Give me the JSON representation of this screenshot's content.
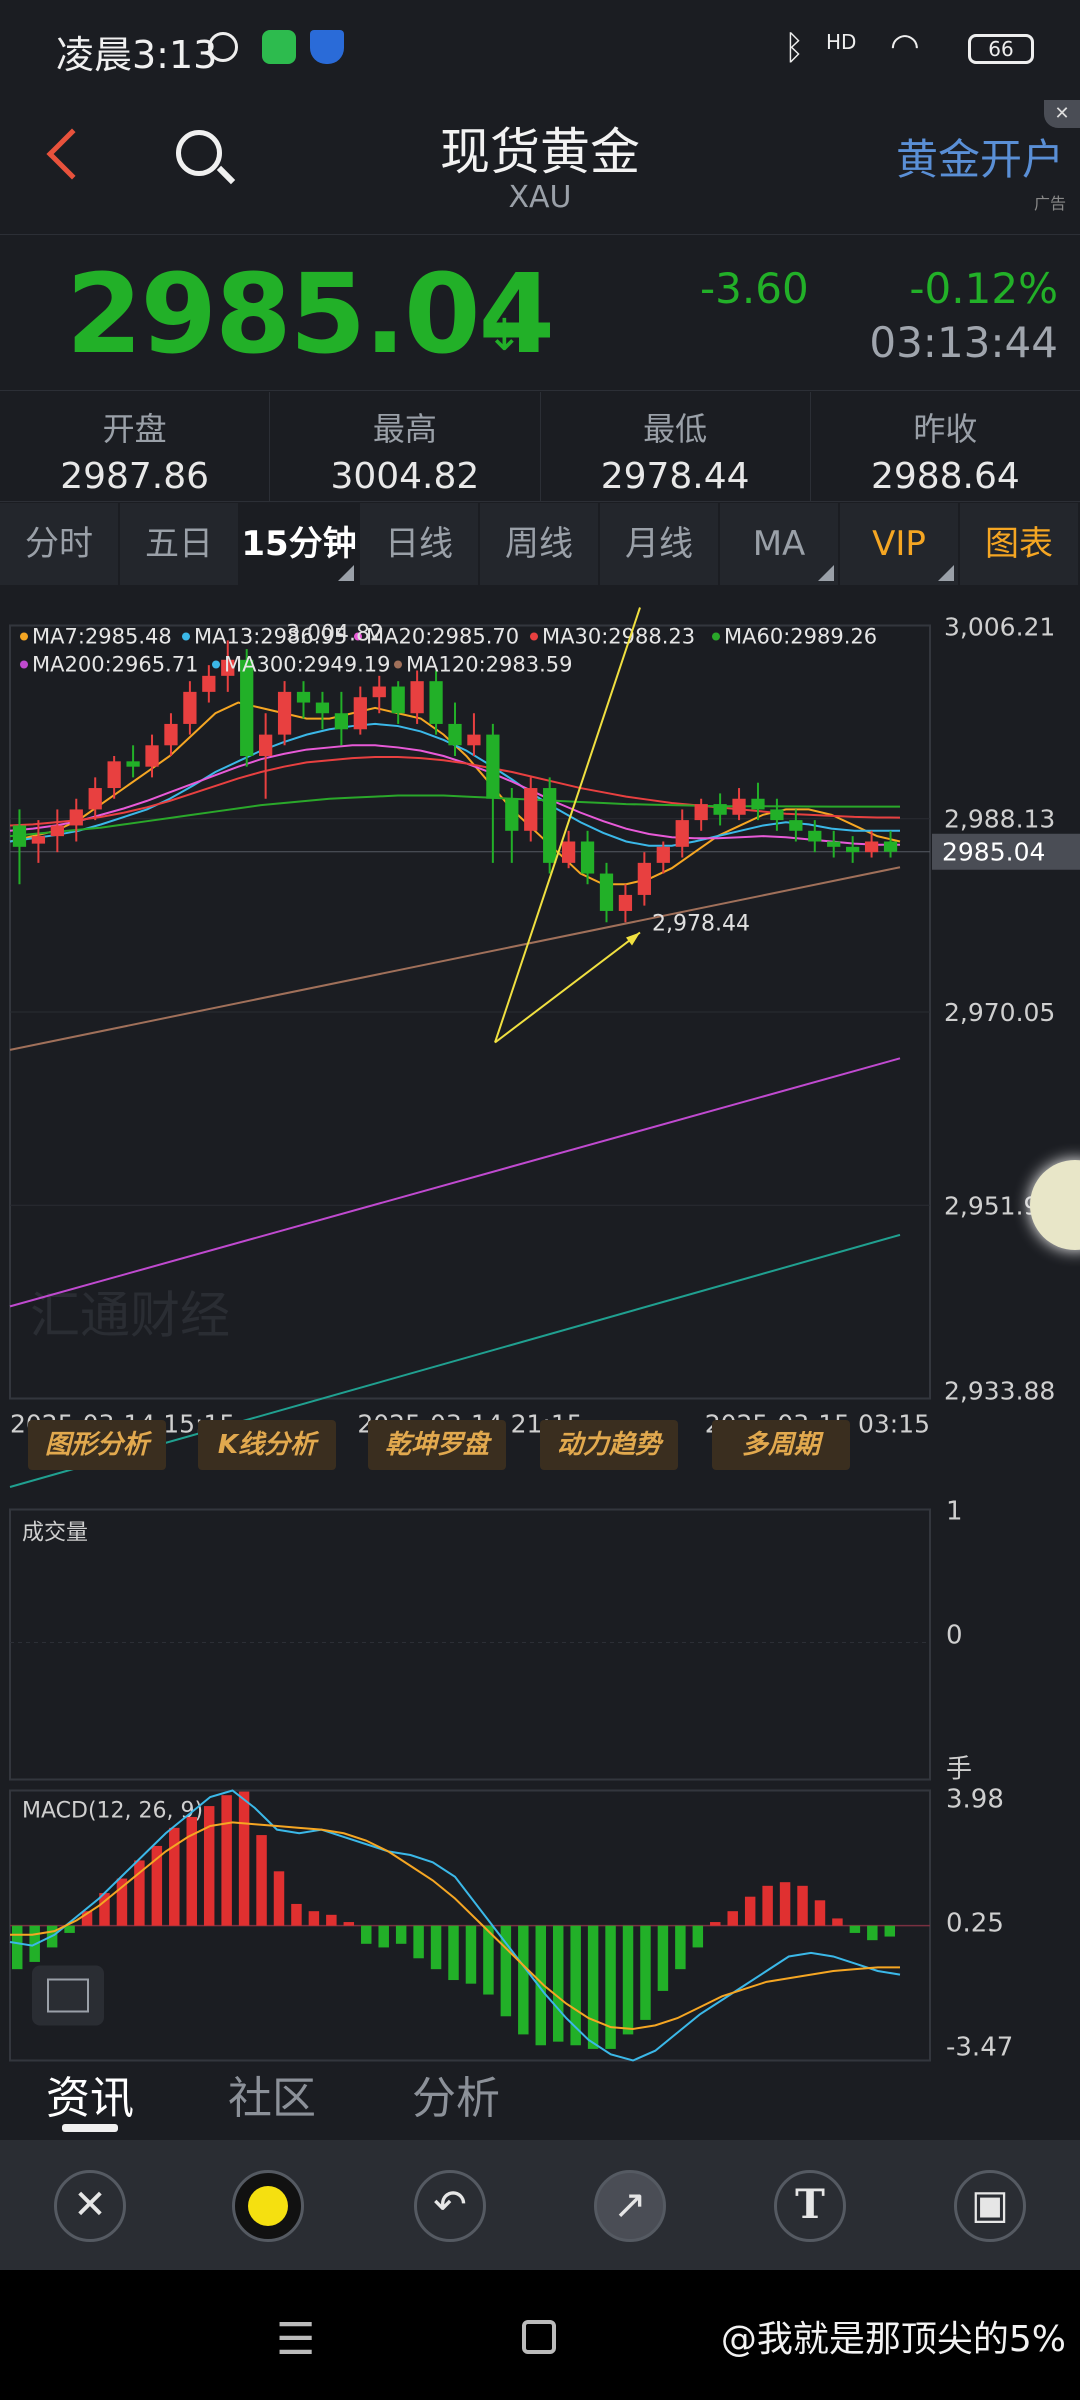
{
  "status_bar": {
    "time": "凌晨3:13",
    "battery": "66",
    "signal_label": "HD"
  },
  "header": {
    "back_icon": "chevron-left-icon",
    "search_icon": "search-icon",
    "title": "现货黄金",
    "subtitle": "XAU",
    "ad_text": "黄金开户",
    "ad_tag": "广告"
  },
  "quote": {
    "price": "2985.04",
    "change": "-3.60",
    "change_pct": "-0.12%",
    "time": "03:13:44",
    "color": "#22b028"
  },
  "stats": [
    {
      "label": "开盘",
      "value": "2987.86"
    },
    {
      "label": "最高",
      "value": "3004.82"
    },
    {
      "label": "最低",
      "value": "2978.44"
    },
    {
      "label": "昨收",
      "value": "2988.64"
    }
  ],
  "tabs": [
    {
      "label": "分时"
    },
    {
      "label": "五日"
    },
    {
      "label": "15分钟"
    },
    {
      "label": "日线"
    },
    {
      "label": "周线"
    },
    {
      "label": "月线"
    },
    {
      "label": "MA"
    },
    {
      "label": "VIP"
    },
    {
      "label": "图表"
    }
  ],
  "ma_legend": [
    {
      "text": "MA7:2985.48",
      "color": "#f5a623"
    },
    {
      "text": "MA13:2986.95",
      "color": "#3bb8e8"
    },
    {
      "text": "MA20:2985.70",
      "color": "#e85ad8"
    },
    {
      "text": "MA30:2988.23",
      "color": "#e84040"
    },
    {
      "text": "MA60:2989.26",
      "color": "#2aa82a"
    },
    {
      "text": "MA200:2965.71",
      "color": "#c04ad0"
    },
    {
      "text": "MA300:2949.19",
      "color": "#3bb8e8"
    },
    {
      "text": "MA120:2983.59",
      "color": "#a0705a"
    }
  ],
  "price_axis": {
    "top": "3,006.21",
    "upper": "2,988.13",
    "current": "2985.04",
    "mid": "2,970.05",
    "lower": "2,951.96",
    "bottom": "2,933.88"
  },
  "annotations": {
    "high": "3,004.82",
    "low": "2,978.44"
  },
  "time_axis": [
    "2025-03-14 15:15",
    "2025-03-14 21:15",
    "2025-03-15 03:15"
  ],
  "watermark": "汇通财经",
  "tool_buttons": [
    "图形分析",
    "K线分析",
    "乾坤罗盘",
    "动力趋势",
    "多周期"
  ],
  "volume": {
    "label": "成交量",
    "axis_top": "1",
    "axis_mid": "0",
    "unit": "手"
  },
  "macd": {
    "label": "MACD(12, 26, 9)",
    "axis_top": "3.98",
    "axis_mid": "0.25",
    "axis_bottom": "-3.47"
  },
  "news_tabs": [
    "资讯",
    "社区",
    "分析"
  ],
  "draw_tools": [
    "close-icon",
    "color-yellow-icon",
    "undo-icon",
    "arrow-icon",
    "text-icon",
    "save-icon"
  ],
  "draw_tool_glyphs": [
    "✕",
    "",
    "↶",
    "↗",
    "T",
    "▣"
  ],
  "watermark_footer": "@我就是那顶尖的5%",
  "chart_data": {
    "type": "candlestick",
    "title": "",
    "ylim": [
      2933.88,
      3006.21
    ],
    "candles": [
      [
        2987.5,
        2985.5,
        2989.0,
        2982.0
      ],
      [
        2985.8,
        2986.5,
        2988.0,
        2984.0
      ],
      [
        2986.5,
        2987.5,
        2989.0,
        2985.0
      ],
      [
        2987.5,
        2989.0,
        2990.0,
        2986.0
      ],
      [
        2989.0,
        2991.0,
        2992.0,
        2988.0
      ],
      [
        2991.0,
        2993.5,
        2994.0,
        2990.0
      ],
      [
        2993.5,
        2993.0,
        2995.0,
        2992.0
      ],
      [
        2993.0,
        2995.0,
        2996.0,
        2992.0
      ],
      [
        2995.0,
        2997.0,
        2998.0,
        2994.0
      ],
      [
        2997.0,
        3000.0,
        3001.0,
        2996.0
      ],
      [
        3000.0,
        3001.5,
        3002.5,
        2999.0
      ],
      [
        3001.5,
        3003.0,
        3004.82,
        3000.0
      ],
      [
        3003.0,
        2994.0,
        3004.0,
        2993.0
      ],
      [
        2994.0,
        2996.0,
        2998.0,
        2990.0
      ],
      [
        2996.0,
        3000.0,
        3001.0,
        2995.0
      ],
      [
        3000.0,
        2999.0,
        3001.0,
        2997.5
      ],
      [
        2999.0,
        2998.0,
        3000.0,
        2996.5
      ],
      [
        2998.0,
        2996.5,
        3000.0,
        2995.0
      ],
      [
        2996.5,
        2999.5,
        3000.5,
        2996.0
      ],
      [
        2999.5,
        3000.5,
        3001.5,
        2998.0
      ],
      [
        3000.5,
        2998.0,
        3001.0,
        2997.0
      ],
      [
        2998.0,
        3001.0,
        3002.0,
        2997.0
      ],
      [
        3001.0,
        2997.0,
        3002.0,
        2996.0
      ],
      [
        2997.0,
        2995.0,
        2999.0,
        2994.0
      ],
      [
        2995.0,
        2996.0,
        2998.0,
        2994.0
      ],
      [
        2996.0,
        2990.0,
        2997.0,
        2984.0
      ],
      [
        2990.0,
        2987.0,
        2991.0,
        2984.0
      ],
      [
        2987.0,
        2991.0,
        2992.0,
        2986.0
      ],
      [
        2991.0,
        2984.0,
        2992.0,
        2983.0
      ],
      [
        2984.0,
        2986.0,
        2987.0,
        2983.5
      ],
      [
        2986.0,
        2983.0,
        2987.0,
        2982.0
      ],
      [
        2983.0,
        2979.5,
        2984.0,
        2978.44
      ],
      [
        2979.5,
        2981.0,
        2982.0,
        2978.44
      ],
      [
        2981.0,
        2984.0,
        2985.0,
        2980.0
      ],
      [
        2984.0,
        2985.5,
        2986.0,
        2983.0
      ],
      [
        2985.5,
        2988.0,
        2989.0,
        2984.5
      ],
      [
        2988.0,
        2989.5,
        2990.0,
        2987.0
      ],
      [
        2989.5,
        2988.5,
        2990.5,
        2987.5
      ],
      [
        2988.5,
        2990.0,
        2991.0,
        2988.0
      ],
      [
        2990.0,
        2989.0,
        2991.5,
        2988.0
      ],
      [
        2989.0,
        2988.0,
        2990.0,
        2987.0
      ],
      [
        2988.0,
        2987.0,
        2989.0,
        2986.0
      ],
      [
        2987.0,
        2986.0,
        2988.0,
        2985.0
      ],
      [
        2986.0,
        2985.5,
        2987.0,
        2984.5
      ],
      [
        2985.5,
        2985.0,
        2986.5,
        2984.0
      ],
      [
        2985.0,
        2986.0,
        2987.0,
        2984.5
      ],
      [
        2986.0,
        2985.04,
        2987.0,
        2984.5
      ]
    ],
    "ma_lines": {
      "MA7": [
        2986,
        2986.5,
        2987,
        2988,
        2989.5,
        2991,
        2992.5,
        2994,
        2996,
        2998,
        2999,
        2998.5,
        2998,
        2997.5,
        2997.5,
        2998,
        2998.5,
        2998,
        2997.5,
        2996,
        2994,
        2991.5,
        2989,
        2987,
        2985,
        2983,
        2982,
        2982,
        2982.5,
        2983.5,
        2985,
        2986.5,
        2987.5,
        2988.5,
        2989,
        2989,
        2988.5,
        2987.5,
        2986.5,
        2986
      ],
      "MA13": [
        2986,
        2986.3,
        2986.6,
        2987,
        2987.6,
        2988.3,
        2989,
        2990,
        2991.2,
        2992.5,
        2993.5,
        2994.5,
        2995.3,
        2996,
        2996.5,
        2996.8,
        2997,
        2996.8,
        2996.3,
        2995.5,
        2994.5,
        2993.2,
        2991.8,
        2990.3,
        2989,
        2987.8,
        2986.8,
        2986,
        2985.6,
        2985.6,
        2986,
        2986.5,
        2987,
        2987.5,
        2987.8,
        2987.6,
        2987.2,
        2987,
        2987,
        2987
      ],
      "MA30": [
        2987.5,
        2987.6,
        2987.8,
        2988,
        2988.3,
        2988.7,
        2989.2,
        2989.8,
        2990.5,
        2991.2,
        2991.9,
        2992.5,
        2993,
        2993.4,
        2993.6,
        2993.8,
        2993.9,
        2993.9,
        2993.8,
        2993.6,
        2993.3,
        2992.9,
        2992.5,
        2992,
        2991.5,
        2991,
        2990.6,
        2990.2,
        2989.9,
        2989.6,
        2989.4,
        2989.2,
        2989,
        2988.8,
        2988.6,
        2988.5,
        2988.4,
        2988.3,
        2988.25,
        2988.23
      ],
      "MA20": [
        2987,
        2987.2,
        2987.5,
        2987.9,
        2988.5,
        2989.1,
        2989.8,
        2990.6,
        2991.4,
        2992.2,
        2993,
        2993.7,
        2994.2,
        2994.6,
        2994.8,
        2995,
        2995,
        2994.8,
        2994.5,
        2994,
        2993.3,
        2992.5,
        2991.6,
        2990.6,
        2989.6,
        2988.7,
        2987.9,
        2987.2,
        2986.7,
        2986.4,
        2986.3,
        2986.3,
        2986.4,
        2986.5,
        2986.4,
        2986.2,
        2986,
        2985.8,
        2985.7,
        2985.7
      ],
      "MA60": [
        2986.5,
        2986.7,
        2986.9,
        2987.1,
        2987.3,
        2987.6,
        2987.9,
        2988.2,
        2988.5,
        2988.8,
        2989.1,
        2989.4,
        2989.6,
        2989.8,
        2990,
        2990.1,
        2990.2,
        2990.3,
        2990.3,
        2990.3,
        2990.2,
        2990.1,
        2990,
        2989.9,
        2989.8,
        2989.7,
        2989.6,
        2989.5,
        2989.45,
        2989.4,
        2989.35,
        2989.3,
        2989.3,
        2989.3,
        2989.28,
        2989.27,
        2989.26,
        2989.26,
        2989.26,
        2989.26
      ],
      "MA120": [
        2966.5,
        2983.59
      ],
      "MA200": [
        2942.5,
        2965.71
      ],
      "MA300": [
        2925.6,
        2949.19
      ]
    },
    "volume": [],
    "macd": {
      "hist": [
        -1.2,
        -1.0,
        -0.6,
        -0.2,
        0.4,
        0.9,
        1.3,
        1.8,
        2.2,
        2.7,
        3.0,
        3.3,
        3.6,
        3.7,
        2.5,
        1.5,
        0.6,
        0.4,
        0.3,
        0.1,
        -0.5,
        -0.6,
        -0.5,
        -0.9,
        -1.2,
        -1.5,
        -1.6,
        -1.9,
        -2.5,
        -3.0,
        -3.3,
        -3.2,
        -3.3,
        -3.4,
        -3.4,
        -3.0,
        -2.6,
        -1.8,
        -1.2,
        -0.6,
        0.1,
        0.4,
        0.8,
        1.1,
        1.2,
        1.1,
        0.7,
        0.2,
        -0.2,
        -0.4,
        -0.3
      ],
      "dif": [
        -0.2,
        -0.3,
        0,
        0.5,
        1.0,
        1.6,
        2.2,
        2.8,
        3.3,
        3.8,
        3.98,
        3.5,
        2.9,
        2.8,
        2.9,
        2.7,
        2.5,
        2.3,
        2.2,
        2.0,
        1.6,
        0.8,
        0,
        -0.8,
        -1.6,
        -2.3,
        -2.9,
        -3.3,
        -3.47,
        -3.2,
        -2.7,
        -2.2,
        -1.8,
        -1.4,
        -1.0,
        -0.6,
        -0.5,
        -0.6,
        -0.8,
        -1.0,
        -1.1
      ],
      "dea": [
        0,
        0,
        0.1,
        0.4,
        0.8,
        1.3,
        1.8,
        2.3,
        2.7,
        3.0,
        3.1,
        3.05,
        3.0,
        2.95,
        2.9,
        2.8,
        2.6,
        2.3,
        1.9,
        1.5,
        1.0,
        0.4,
        -0.2,
        -0.8,
        -1.4,
        -1.9,
        -2.3,
        -2.55,
        -2.6,
        -2.5,
        -2.3,
        -2.0,
        -1.7,
        -1.5,
        -1.3,
        -1.2,
        -1.1,
        -1.0,
        -0.95,
        -0.9,
        -0.9
      ]
    }
  }
}
